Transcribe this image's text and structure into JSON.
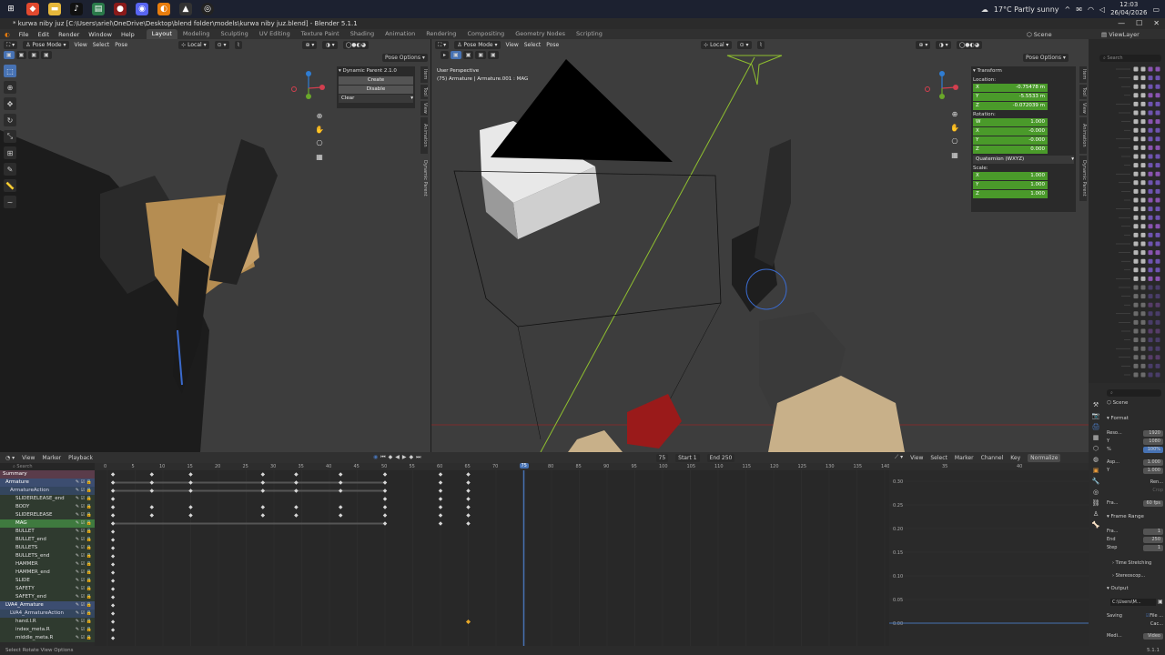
{
  "taskbar": {
    "weather": "17°C  Partly sunny",
    "time": "12:03",
    "date": "26/04/2026"
  },
  "window": {
    "title": "* kurwa niby juz [C:\\Users\\ariel\\OneDrive\\Desktop\\blend folder\\models\\kurwa niby juz.blend] - Blender 5.1.1"
  },
  "topbar": {
    "menus": [
      "File",
      "Edit",
      "Render",
      "Window",
      "Help"
    ],
    "workspaces": [
      "Layout",
      "Modeling",
      "Sculpting",
      "UV Editing",
      "Texture Paint",
      "Shading",
      "Animation",
      "Rendering",
      "Compositing",
      "Geometry Nodes",
      "Scripting"
    ],
    "active_workspace": "Layout",
    "scene": "Scene",
    "view_layer": "ViewLayer"
  },
  "left_viewport": {
    "mode": "Pose Mode",
    "menus": [
      "View",
      "Select",
      "Pose"
    ],
    "orientation": "Local",
    "pose_options": "Pose Options",
    "panel": {
      "title": "Dynamic Parent 2.1.0",
      "create": "Create",
      "disable": "Disable",
      "clear": "Clear"
    },
    "side_tabs": [
      "Item",
      "Tool",
      "View",
      "Animation",
      "Dynamic Parent"
    ]
  },
  "right_viewport": {
    "mode": "Pose Mode",
    "menus": [
      "View",
      "Select",
      "Pose"
    ],
    "orientation": "Local",
    "pose_options": "Pose Options",
    "overlay_line1": "User Perspective",
    "overlay_line2": "(75) Armature | Armature.001 : MAG",
    "transform": {
      "title": "Transform",
      "location_label": "Location:",
      "location": [
        {
          "axis": "X",
          "value": "-0.75478 m"
        },
        {
          "axis": "Y",
          "value": "-5.5533 m"
        },
        {
          "axis": "Z",
          "value": "-0.072039 m"
        }
      ],
      "rotation_label": "Rotation:",
      "rotation": [
        {
          "axis": "W",
          "value": "1.000"
        },
        {
          "axis": "X",
          "value": "-0.000"
        },
        {
          "axis": "Y",
          "value": "-0.000"
        },
        {
          "axis": "Z",
          "value": "0.000"
        }
      ],
      "rotation_mode": "Quaternion (WXYZ)",
      "scale_label": "Scale:",
      "scale": [
        {
          "axis": "X",
          "value": "1.000"
        },
        {
          "axis": "Y",
          "value": "1.000"
        },
        {
          "axis": "Z",
          "value": "1.000"
        }
      ]
    },
    "side_tabs": [
      "Item",
      "Tool",
      "View",
      "Animation",
      "Dynamic Parent"
    ]
  },
  "dopesheet": {
    "menus": [
      "View",
      "Marker",
      "Playback"
    ],
    "current_frame": "75",
    "start_label": "Start",
    "start": "1",
    "end_label": "End",
    "end": "250",
    "search_placeholder": "Search",
    "ruler": [
      "0",
      "5",
      "10",
      "15",
      "20",
      "25",
      "30",
      "35",
      "40",
      "45",
      "50",
      "55",
      "60",
      "65",
      "70",
      "75",
      "80",
      "85",
      "90",
      "95",
      "100",
      "105",
      "110",
      "115",
      "120",
      "125",
      "130",
      "135",
      "140"
    ],
    "channels": [
      {
        "name": "Summary",
        "kind": "summary"
      },
      {
        "name": "Armature",
        "kind": "obj"
      },
      {
        "name": "ArmatureAction",
        "kind": "action"
      },
      {
        "name": "SLIDERELEASE_end",
        "kind": "group"
      },
      {
        "name": "BODY",
        "kind": "group"
      },
      {
        "name": "SLIDERELEASE",
        "kind": "group"
      },
      {
        "name": "MAG",
        "kind": "sel"
      },
      {
        "name": "BULLET",
        "kind": "group"
      },
      {
        "name": "BULLET_end",
        "kind": "group"
      },
      {
        "name": "BULLETS",
        "kind": "group"
      },
      {
        "name": "BULLETS_end",
        "kind": "group"
      },
      {
        "name": "HAMMER",
        "kind": "group"
      },
      {
        "name": "HAMMER_end",
        "kind": "group"
      },
      {
        "name": "SLIDE",
        "kind": "group"
      },
      {
        "name": "SAFETY",
        "kind": "group"
      },
      {
        "name": "SAFETY_end",
        "kind": "group"
      },
      {
        "name": "LVA4_Armature",
        "kind": "obj"
      },
      {
        "name": "LVA4_ArmatureAction",
        "kind": "action"
      },
      {
        "name": "hand.l.R",
        "kind": "group"
      },
      {
        "name": "index_meta.R",
        "kind": "group"
      },
      {
        "name": "middle_meta.R",
        "kind": "group"
      }
    ]
  },
  "graph_editor": {
    "menus": [
      "View",
      "Select",
      "Marker",
      "Channel",
      "Key"
    ],
    "normalize": "Normalize",
    "ruler": [
      "35",
      "40"
    ],
    "y_labels": [
      "0.30",
      "0.25",
      "0.20",
      "0.15",
      "0.10",
      "0.05",
      "0.00"
    ]
  },
  "properties": {
    "scene_label": "Scene",
    "format_label": "Format",
    "resolution_label": "Reso...",
    "res_x": "1920",
    "res_y": "1080",
    "res_pct": "100%",
    "aspect_label": "Asp...",
    "aspect_x": "1.000",
    "aspect_y": "1.000",
    "render_region": "Ren...",
    "crop": "Crop",
    "frame_rate_label": "Fra...",
    "frame_rate": "60 fps",
    "frame_range_label": "Frame Range",
    "frame_start_label": "Fra...",
    "frame_start": "1",
    "frame_end_label": "End",
    "frame_end": "250",
    "step_label": "Step",
    "step": "1",
    "time_stretching": "Time Stretching",
    "stereoscopy": "Stereoscop...",
    "output_label": "Output",
    "output_path": "C:\\Users\\M...",
    "saving_label": "Saving",
    "file_ext": "File ...",
    "cache": "Cac...",
    "video_label": "Video",
    "media_label": "Medi..."
  },
  "outliner": {
    "search_placeholder": "Search"
  },
  "statusbar": {
    "left": "Select      Rotate View      Options",
    "version": "5.1.1"
  },
  "colors": {
    "accent": "#4772b3",
    "field_green": "#4a9a2a",
    "playhead": "#4772b3",
    "keyframe": "#d7d7d7",
    "keyframe_selected": "#e8a928"
  }
}
